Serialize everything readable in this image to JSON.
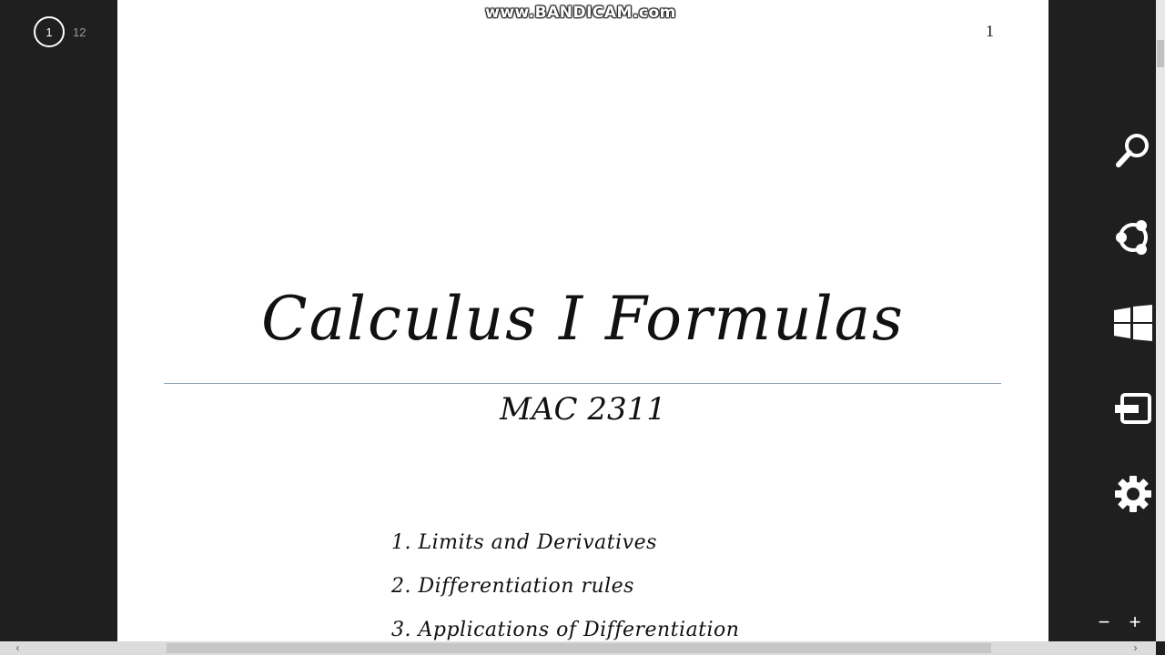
{
  "navigation": {
    "current_page": "1",
    "total_pages": "12"
  },
  "watermark": "www.BANDICAM.com",
  "document": {
    "page_number": "1",
    "title": "Calculus I Formulas",
    "subtitle": "MAC 2311",
    "contents": [
      "1.  Limits and Derivatives",
      "2. Differentiation rules",
      "3. Applications of Differentiation"
    ]
  },
  "charms": [
    {
      "icon": "search-icon"
    },
    {
      "icon": "share-icon"
    },
    {
      "icon": "windows-start-icon"
    },
    {
      "icon": "devices-icon"
    },
    {
      "icon": "settings-gear-icon"
    }
  ],
  "zoom": {
    "out_label": "−",
    "in_label": "+"
  },
  "colors": {
    "background": "#1f1f1f",
    "page": "#ffffff",
    "rule": "#8ea2b4"
  }
}
